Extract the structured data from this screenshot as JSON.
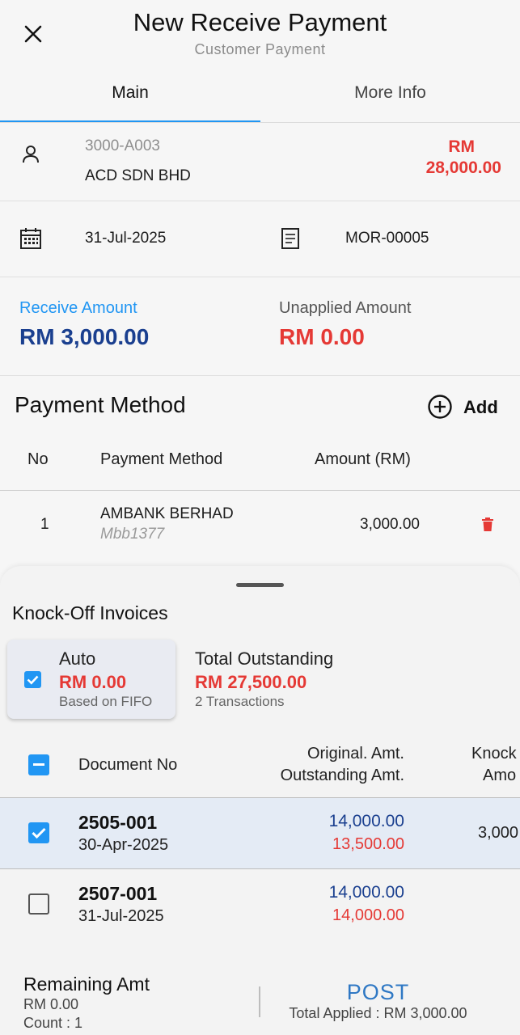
{
  "header": {
    "title": "New Receive Payment",
    "subtitle": "Customer Payment",
    "close_icon": "close-icon"
  },
  "tabs": [
    {
      "label": "Main",
      "active": true
    },
    {
      "label": "More Info",
      "active": false
    }
  ],
  "customer": {
    "code": "3000-A003",
    "name": "ACD SDN BHD",
    "currency": "RM",
    "balance": "28,000.00",
    "icon": "person-icon"
  },
  "doc": {
    "date": "31-Jul-2025",
    "number": "MOR-00005",
    "date_icon": "calendar-icon",
    "number_icon": "document-icon"
  },
  "amounts": {
    "receive_label": "Receive Amount",
    "receive_value": "RM 3,000.00",
    "unapplied_label": "Unapplied Amount",
    "unapplied_value": "RM 0.00"
  },
  "payment_method": {
    "title": "Payment Method",
    "add_label": "Add",
    "col_no": "No",
    "col_method": "Payment Method",
    "col_amount": "Amount (RM)",
    "rows": [
      {
        "no": "1",
        "method": "AMBANK BERHAD",
        "ref": "Mbb1377",
        "amount": "3,000.00"
      }
    ]
  },
  "knockoff": {
    "title": "Knock-Off Invoices",
    "auto": {
      "label": "Auto",
      "value": "RM 0.00",
      "note": "Based on FIFO",
      "checked": true
    },
    "total": {
      "label": "Total Outstanding",
      "value": "RM 27,500.00",
      "note": "2 Transactions"
    },
    "col_doc": "Document No",
    "col_amt_line1": "Original. Amt.",
    "col_amt_line2": "Outstanding Amt.",
    "col_knock_line1": "Knock",
    "col_knock_line2": "Amo",
    "rows": [
      {
        "doc_no": "2505-001",
        "date": "30-Apr-2025",
        "original": "14,000.00",
        "outstanding": "13,500.00",
        "knock": "3,000",
        "checked": true
      },
      {
        "doc_no": "2507-001",
        "date": "31-Jul-2025",
        "original": "14,000.00",
        "outstanding": "14,000.00",
        "knock": "",
        "checked": false
      }
    ]
  },
  "footer": {
    "remaining_label": "Remaining Amt",
    "remaining_value": "RM 0.00",
    "count": "Count : 1",
    "post_label": "POST",
    "total_applied": "Total Applied : RM 3,000.00"
  },
  "colors": {
    "accent": "#2196f3",
    "navy": "#1a3f8f",
    "red": "#e53935"
  }
}
